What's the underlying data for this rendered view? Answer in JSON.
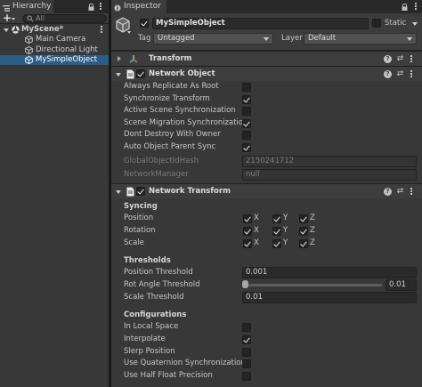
{
  "hierarchy": {
    "tab_label": "Hierarchy",
    "add_label": "+",
    "search_placeholder": "All",
    "scene_name": "MyScene*",
    "items": [
      {
        "label": "Main Camera"
      },
      {
        "label": "Directional Light"
      },
      {
        "label": "MySimpleObject",
        "selected": true
      }
    ]
  },
  "inspector": {
    "tab_label": "Inspector",
    "object_name": "MySimpleObject",
    "object_active": true,
    "static_label": "Static",
    "static_checked": false,
    "tag_label": "Tag",
    "tag_value": "Untagged",
    "layer_label": "Layer",
    "layer_value": "Default",
    "transform": {
      "title": "Transform",
      "collapsed": true
    },
    "network_object": {
      "title": "Network Object",
      "enabled": true,
      "properties": [
        {
          "label": "Always Replicate As Root",
          "checked": false
        },
        {
          "label": "Synchronize Transform",
          "checked": true
        },
        {
          "label": "Active Scene Synchronization",
          "checked": false
        },
        {
          "label": "Scene Migration Synchronization",
          "checked": true
        },
        {
          "label": "Dont Destroy With Owner",
          "checked": false
        },
        {
          "label": "Auto Object Parent Sync",
          "checked": true
        }
      ],
      "readonly": [
        {
          "label": "GlobalObjectIdHash",
          "value": "2150241712"
        },
        {
          "label": "NetworkManager",
          "value": "null"
        }
      ]
    },
    "network_transform": {
      "title": "Network Transform",
      "enabled": true,
      "syncing_label": "Syncing",
      "axis_rows": [
        {
          "label": "Position",
          "x": true,
          "y": true,
          "z": true
        },
        {
          "label": "Rotation",
          "x": true,
          "y": true,
          "z": true
        },
        {
          "label": "Scale",
          "x": true,
          "y": true,
          "z": true
        }
      ],
      "axis_labels": {
        "x": "X",
        "y": "Y",
        "z": "Z"
      },
      "thresholds_label": "Thresholds",
      "position_threshold_label": "Position Threshold",
      "position_threshold_value": "0.001",
      "rot_angle_threshold_label": "Rot Angle Threshold",
      "rot_angle_threshold_value": "0.01",
      "rot_angle_slider_fraction": 0.0,
      "scale_threshold_label": "Scale Threshold",
      "scale_threshold_value": "0.01",
      "configurations_label": "Configurations",
      "configurations": [
        {
          "label": "In Local Space",
          "checked": false
        },
        {
          "label": "Interpolate",
          "checked": true
        },
        {
          "label": "Slerp Position",
          "checked": false
        },
        {
          "label": "Use Quaternion Synchronization",
          "checked": false
        },
        {
          "label": "Use Half Float Precision",
          "checked": false
        }
      ]
    }
  },
  "colors": {
    "selection": "#2c5d87",
    "panel": "#383838",
    "header": "#3d3d3d"
  }
}
